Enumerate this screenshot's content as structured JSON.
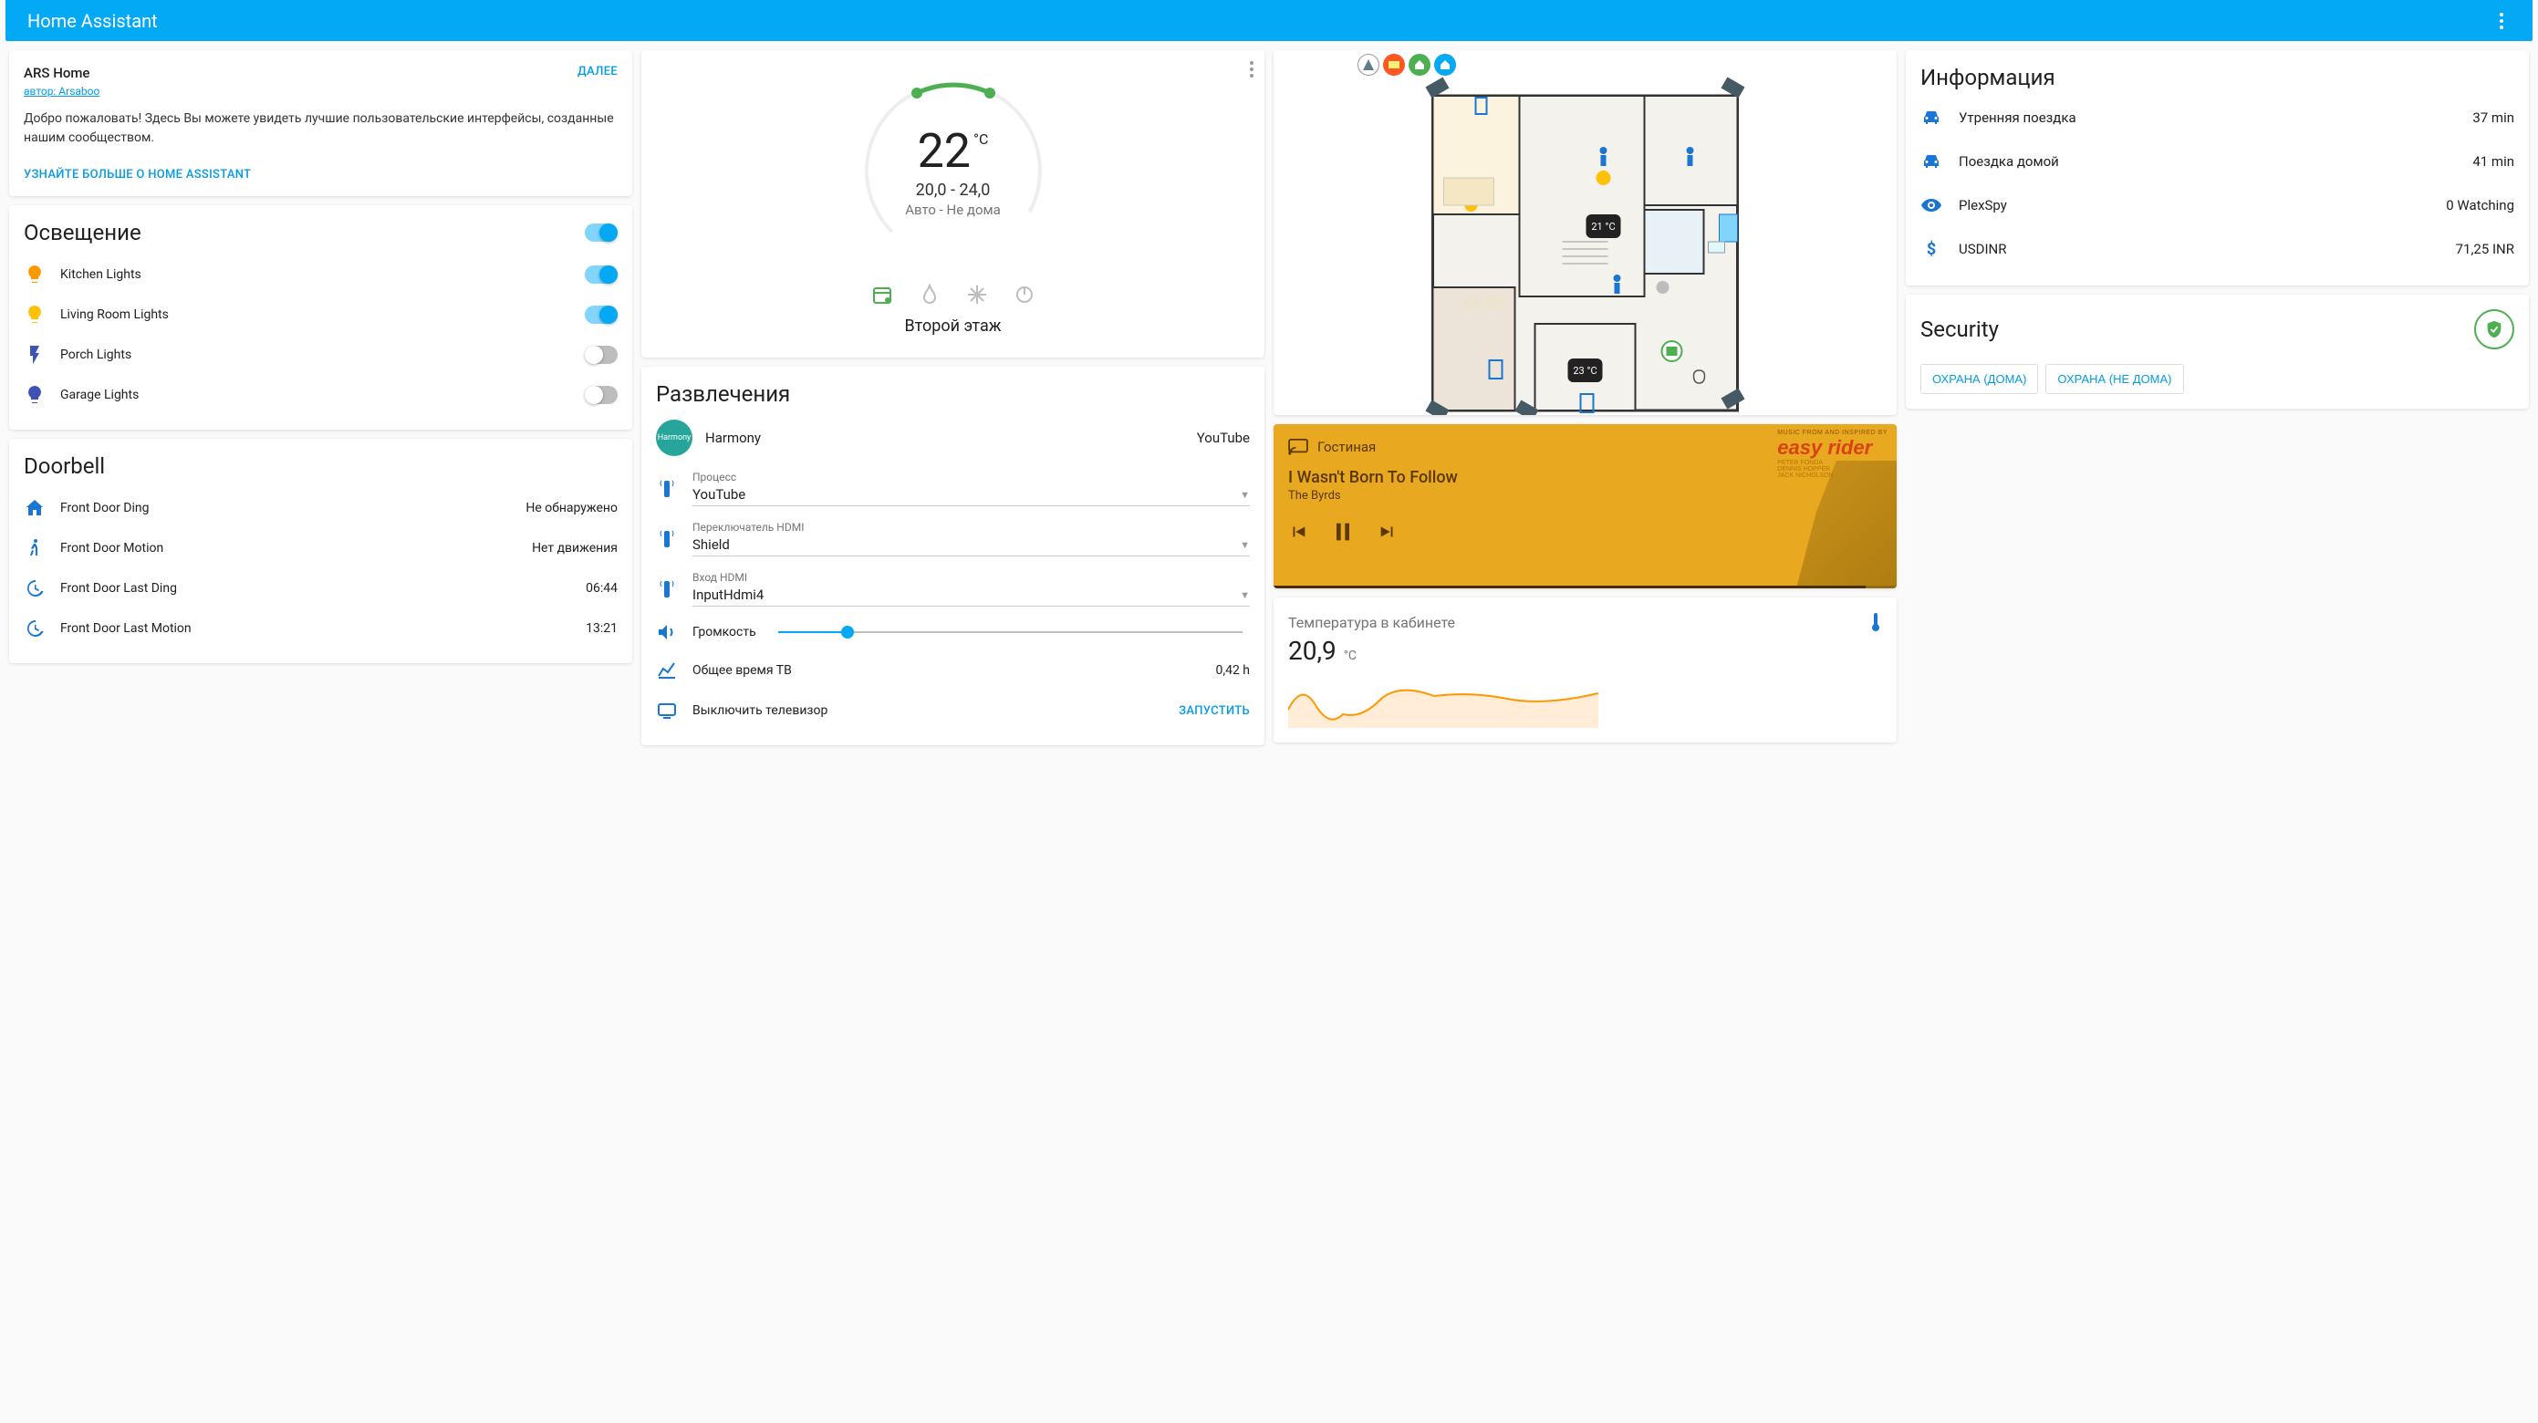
{
  "topbar": {
    "title": "Home Assistant"
  },
  "welcome": {
    "title": "ARS Home",
    "author": "автор: Arsaboo",
    "next": "ДАЛЕЕ",
    "body": "Добро пожаловать! Здесь Вы можете увидеть лучшие пользовательские интерфейсы, созданные нашим сообществом.",
    "learn_more": "УЗНАЙТЕ БОЛЬШЕ О HOME ASSISTANT"
  },
  "lighting": {
    "title": "Освещение",
    "master_on": true,
    "items": [
      {
        "label": "Kitchen Lights",
        "on": true,
        "color": "#ff9800"
      },
      {
        "label": "Living Room Lights",
        "on": true,
        "color": "#ffc107"
      },
      {
        "label": "Porch Lights",
        "on": false,
        "color": "#3f51b5"
      },
      {
        "label": "Garage Lights",
        "on": false,
        "color": "#3f51b5"
      }
    ]
  },
  "doorbell": {
    "title": "Doorbell",
    "items": [
      {
        "label": "Front Door Ding",
        "value": "Не обнаружено",
        "icon": "home"
      },
      {
        "label": "Front Door Motion",
        "value": "Нет движения",
        "icon": "walk"
      },
      {
        "label": "Front Door Last Ding",
        "value": "06:44",
        "icon": "history"
      },
      {
        "label": "Front Door Last Motion",
        "value": "13:21",
        "icon": "history"
      }
    ]
  },
  "thermostat": {
    "temp": "22",
    "unit": "°C",
    "range": "20,0 - 24,0",
    "mode": "Авто - Не дома",
    "name": "Второй этаж"
  },
  "entertainment": {
    "title": "Развлечения",
    "device": "Harmony",
    "source": "YouTube",
    "fields": {
      "process_label": "Процесс",
      "process_value": "YouTube",
      "hdmi_switch_label": "Переключатель HDMI",
      "hdmi_switch_value": "Shield",
      "hdmi_in_label": "Вход HDMI",
      "hdmi_in_value": "InputHdmi4",
      "volume_label": "Громкость",
      "volume_pct": 15,
      "tv_time_label": "Общее время ТВ",
      "tv_time_value": "0,42 h",
      "tv_off_label": "Выключить телевизор",
      "run": "ЗАПУСТИТЬ"
    }
  },
  "floorplan": {
    "badges": [
      {
        "bg": "#607d8b",
        "icon": "▲"
      },
      {
        "bg": "#ff9800",
        "icon": "◧"
      },
      {
        "bg": "#4caf50",
        "icon": "⌂"
      },
      {
        "bg": "#03a9f4",
        "icon": "⌂"
      }
    ],
    "temps": {
      "room1": "21 °C",
      "room2": "23 °C"
    }
  },
  "media": {
    "room": "Гостиная",
    "title": "I Wasn't Born To Follow",
    "artist": "The Byrds",
    "logo_line1": "MUSIC FROM AND INSPIRED BY",
    "logo_line2": "easy rider",
    "credits": "PETER FONDA\nDENNIS HOPPER\nJACK NICHOLSON"
  },
  "sensor": {
    "name": "Температура в кабинете",
    "value": "20,9",
    "unit": "°C"
  },
  "info": {
    "title": "Информация",
    "items": [
      {
        "label": "Утренняя поездка",
        "value": "37 min",
        "icon": "car"
      },
      {
        "label": "Поездка домой",
        "value": "41 min",
        "icon": "car"
      },
      {
        "label": "PlexSpy",
        "value": "0 Watching",
        "icon": "eye"
      },
      {
        "label": "USDINR",
        "value": "71,25 INR",
        "icon": "dollar"
      }
    ]
  },
  "security": {
    "title": "Security",
    "btn_home": "ОХРАНА (ДОМА)",
    "btn_away": "ОХРАНА (НЕ ДОМА)"
  }
}
